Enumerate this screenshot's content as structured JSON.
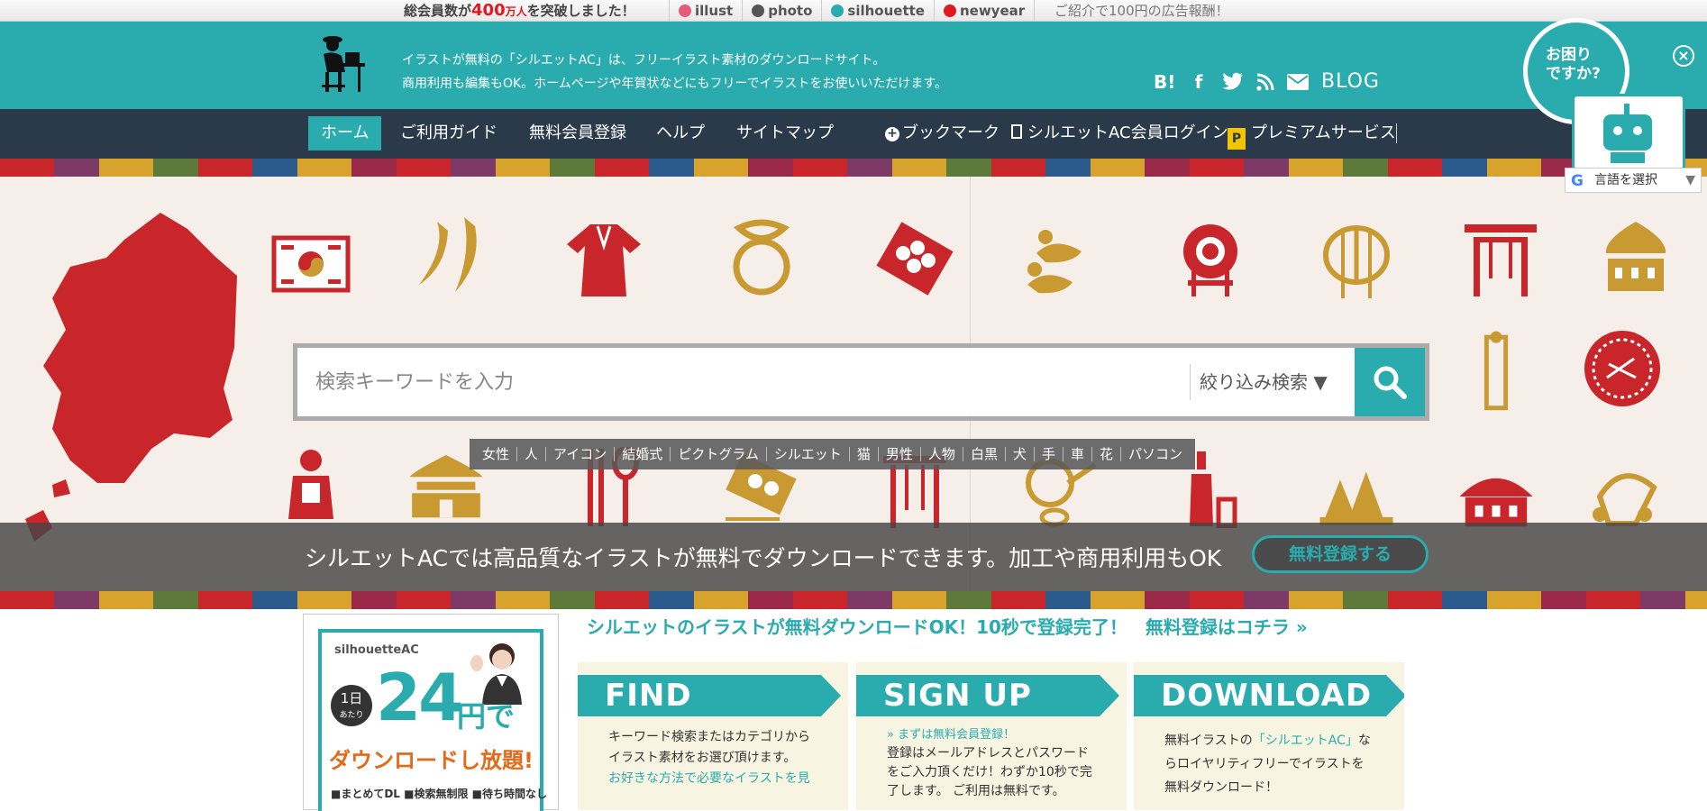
{
  "topbar": {
    "notice_pre": "総会員数が",
    "notice_num": "400",
    "notice_unit": "万人",
    "notice_post": "を突破しました！",
    "sites": [
      {
        "label": "illust",
        "icon": "illust-icon",
        "color": "#e85a7a"
      },
      {
        "label": "photo",
        "icon": "photo-icon",
        "color": "#555555"
      },
      {
        "label": "silhouette",
        "icon": "silhouette-icon",
        "color": "#2aacaf"
      },
      {
        "label": "newyear",
        "icon": "newyear-icon",
        "color": "#e0191f"
      }
    ],
    "promo": "ご紹介で100円の広告報酬！"
  },
  "header": {
    "tagline_1": "イラストが無料の「シルエットAC」は、フリーイラスト素材のダウンロードサイト。",
    "tagline_2": "商用利用も編集もOK。ホームページや年賀状などにもフリーでイラストをお使いいただけます。",
    "social": {
      "hatena": "B!",
      "facebook": "f",
      "blog": "BLOG"
    }
  },
  "nav": {
    "home": "ホーム",
    "guide": "ご利用ガイド",
    "register": "無料会員登録",
    "help": "ヘルプ",
    "sitemap": "サイトマップ",
    "bookmark": "ブックマーク",
    "login": "シルエットAC会員ログイン",
    "premium": "プレミアムサービス"
  },
  "search": {
    "placeholder": "検索キーワードを入力",
    "filter": "絞り込み検索 ▼"
  },
  "tags": [
    "女性",
    "人",
    "アイコン",
    "結婚式",
    "ピクトグラム",
    "シルエット",
    "猫",
    "男性",
    "人物",
    "白黒",
    "犬",
    "手",
    "車",
    "花",
    "パソコン"
  ],
  "hero": {
    "message": "シルエットACでは高品質なイラストが無料でダウンロードできます。加工や商用利用もOK",
    "register_button": "無料登録する"
  },
  "help_widget": {
    "line1": "お困り",
    "line2": "ですか?",
    "close": "×"
  },
  "language": {
    "label": "言語を選択",
    "arrow": "▼"
  },
  "ad": {
    "brand": "silhouetteAC",
    "day_top": "1日",
    "day_sub": "あたり",
    "price": "24",
    "yen": "円で",
    "dl": "ダウンロードし放題!",
    "features": "■まとめてDL ■検索無制限 ■待ち時間なし"
  },
  "lead": "シルエットのイラストが無料ダウンロードOK！10秒で登録完了！　無料登録はコチラ »",
  "steps": [
    {
      "title": "FIND",
      "lines": [
        "キーワード検索またはカテゴリから",
        "イラスト素材をお選び頂けます。"
      ],
      "accent": "お好きな方法で必要なイラストを見"
    },
    {
      "title": "SIGN UP",
      "accent_top": "» まずは無料会員登録！",
      "lines": [
        "登録はメールアドレスとパスワード",
        "をご入力頂くだけ！わずか10秒で完",
        "了します。 ご利用は無料です。"
      ]
    },
    {
      "title": "DOWNLOAD",
      "lines_pre": "無料イラストの",
      "lines_accent": "「シルエットAC」",
      "lines_post": "な",
      "lines": [
        "らロイヤリティフリーでイラストを",
        "無料ダウンロード！"
      ]
    }
  ],
  "colors": {
    "teal": "#2aacaf",
    "nav": "#2b3a4a",
    "red": "#c9262b",
    "gold": "#c99a32"
  }
}
